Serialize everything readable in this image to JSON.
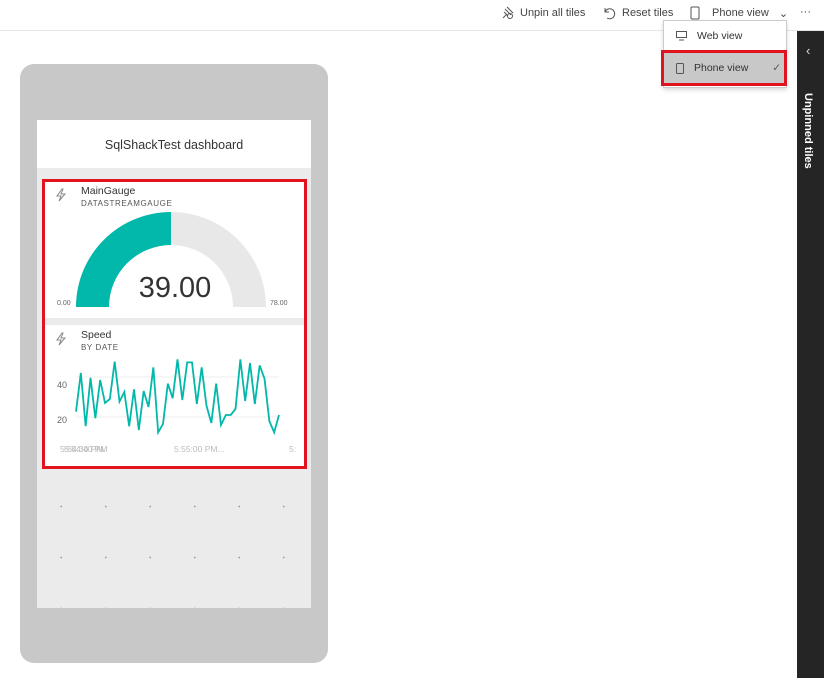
{
  "toolbar": {
    "unpin": "Unpin all tiles",
    "reset": "Reset tiles",
    "view": "Phone view",
    "more": "···"
  },
  "dropdown": {
    "items": [
      {
        "label": "Web view",
        "icon": "monitor-icon"
      },
      {
        "label": "Phone view",
        "icon": "phone-icon",
        "selected": true,
        "check": "✓"
      }
    ]
  },
  "sidebar": {
    "label": "Unpinned tiles",
    "chevron": "‹"
  },
  "dashboard": {
    "title": "SqlShackTest dashboard"
  },
  "gauge_tile": {
    "title": "MainGauge",
    "subtitle": "DATASTREAMGAUGE",
    "value": "39.00",
    "min": "0.00",
    "max": "78.00",
    "fill_color": "#01b8aa",
    "track_color": "#e8e8e8"
  },
  "speed_tile": {
    "title": "Speed",
    "subtitle": "BY DATE",
    "line_color": "#01b8aa",
    "y_ticks": [
      "40",
      "20"
    ],
    "x_labels": [
      "5:54:30 PM.",
      "5:54:40 PM",
      "5:55:00 PM...",
      "5:"
    ]
  },
  "chart_data": {
    "type": "line",
    "y_ticks": [
      20,
      40
    ],
    "ylim": [
      8,
      53
    ],
    "values": [
      22.7,
      42,
      15.4,
      39.6,
      19.4,
      38.5,
      27,
      29,
      47.7,
      27.7,
      32.5,
      15.4,
      33.8,
      13.5,
      33,
      25,
      44.8,
      12.3,
      16.5,
      36.7,
      29.4,
      48.8,
      28.5,
      47.3,
      47.3,
      26.5,
      44.8,
      25.6,
      17,
      36.7,
      16,
      21,
      21,
      24,
      48.8,
      28,
      47,
      26.5,
      45.8,
      39.2,
      18,
      12.3,
      21
    ]
  }
}
